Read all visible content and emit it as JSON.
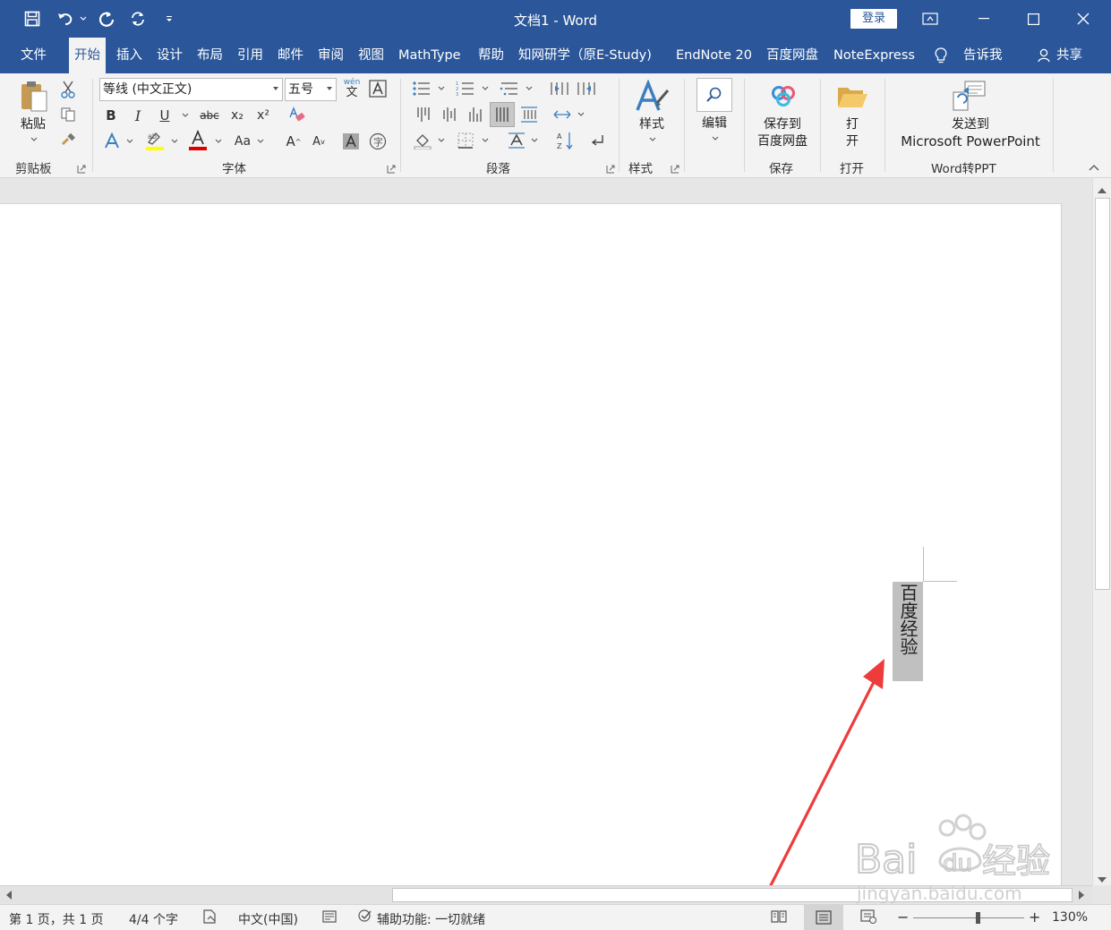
{
  "window": {
    "title": "文档1  -  Word",
    "login_label": "登录"
  },
  "tabs": {
    "file": "文件",
    "home": "开始",
    "insert": "插入",
    "design": "设计",
    "layout": "布局",
    "references": "引用",
    "mailings": "邮件",
    "review": "审阅",
    "view": "视图",
    "mathtype": "MathType",
    "help": "帮助",
    "cnki": "知网研学（原E-Study)",
    "endnote": "EndNote 20",
    "baidu": "百度网盘",
    "noteexpress": "NoteExpress",
    "tell_me": "告诉我",
    "share": "共享"
  },
  "ribbon": {
    "clipboard": {
      "paste": "粘贴",
      "label": "剪贴板"
    },
    "font": {
      "font_name": "等线 (中文正文)",
      "font_size": "五号",
      "bold": "B",
      "italic": "I",
      "underline": "U",
      "strike": "abc",
      "sub": "x₂",
      "sup": "x²",
      "change_case": "Aa",
      "grow": "A",
      "shrink": "A",
      "phonetic": "wén",
      "label": "字体"
    },
    "paragraph": {
      "label": "段落"
    },
    "styles": {
      "styles_btn": "样式",
      "label": "样式"
    },
    "editing": {
      "edit_btn": "编辑"
    },
    "save": {
      "line1": "保存到",
      "line2": "百度网盘",
      "label": "保存"
    },
    "open": {
      "line1": "打",
      "line2": "开",
      "label": "打开"
    },
    "ppt": {
      "line1": "发送到",
      "line2": "Microsoft PowerPoint",
      "label": "Word转PPT"
    }
  },
  "document": {
    "text_box": "百度经验"
  },
  "statusbar": {
    "page": "第 1 页，共 1 页",
    "words": "4/4 个字",
    "language": "中文(中国)",
    "accessibility": "辅助功能: 一切就绪",
    "zoom": "130%",
    "zoom_level": 0.58
  },
  "watermark": {
    "text1": "Bai",
    "text2": "du",
    "text3": "经验",
    "url": "jingyan.baidu.com"
  },
  "colors": {
    "title_bar": "#2b579a",
    "arrow": "#ee3b3b",
    "text_box_fill": "#c0c0c0"
  }
}
